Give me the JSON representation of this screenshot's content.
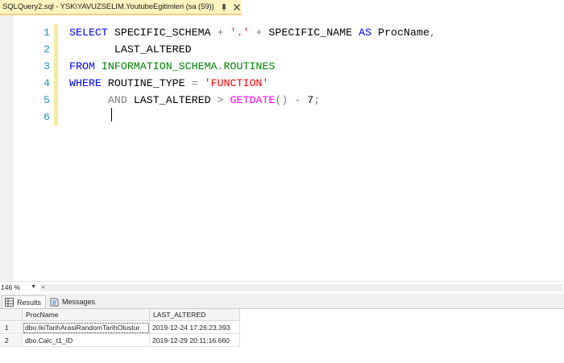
{
  "window": {
    "doc_tab_title": "SQLQuery2.sql - YSK\\YAVUZSELIM.YoutubeEgitimleri (sa (59))",
    "pin_icon": "pin-icon",
    "close_icon": "close-icon"
  },
  "editor": {
    "line_numbers": [
      "1",
      "2",
      "3",
      "4",
      "5",
      "6"
    ],
    "lines": [
      [
        {
          "c": "kw",
          "t": "SELECT"
        },
        {
          "c": "txt",
          "t": " SPECIFIC_SCHEMA "
        },
        {
          "c": "op",
          "t": "+"
        },
        {
          "c": "txt",
          "t": " "
        },
        {
          "c": "str",
          "t": "'.'"
        },
        {
          "c": "txt",
          "t": " "
        },
        {
          "c": "op",
          "t": "+"
        },
        {
          "c": "txt",
          "t": " SPECIFIC_NAME "
        },
        {
          "c": "kw",
          "t": "AS"
        },
        {
          "c": "txt",
          "t": " ProcName"
        },
        {
          "c": "op",
          "t": ","
        }
      ],
      [
        {
          "c": "txt",
          "t": "       LAST_ALTERED"
        }
      ],
      [
        {
          "c": "kw",
          "t": "FROM"
        },
        {
          "c": "txt",
          "t": " "
        },
        {
          "c": "sys",
          "t": "INFORMATION_SCHEMA"
        },
        {
          "c": "op",
          "t": "."
        },
        {
          "c": "sys",
          "t": "ROUTINES"
        }
      ],
      [
        {
          "c": "kw",
          "t": "WHERE"
        },
        {
          "c": "txt",
          "t": " ROUTINE_TYPE "
        },
        {
          "c": "op",
          "t": "="
        },
        {
          "c": "txt",
          "t": " "
        },
        {
          "c": "str",
          "t": "'FUNCTION'"
        }
      ],
      [
        {
          "c": "txt",
          "t": "      "
        },
        {
          "c": "op",
          "t": "AND"
        },
        {
          "c": "txt",
          "t": " LAST_ALTERED "
        },
        {
          "c": "op",
          "t": ">"
        },
        {
          "c": "txt",
          "t": " "
        },
        {
          "c": "fn",
          "t": "GETDATE"
        },
        {
          "c": "op",
          "t": "()"
        },
        {
          "c": "txt",
          "t": " "
        },
        {
          "c": "op",
          "t": "-"
        },
        {
          "c": "txt",
          "t": " 7"
        },
        {
          "c": "op",
          "t": ";"
        }
      ],
      []
    ]
  },
  "status": {
    "zoom_value": "146 %"
  },
  "results": {
    "tabs": [
      {
        "label": "Results",
        "icon": "grid-icon"
      },
      {
        "label": "Messages",
        "icon": "messages-icon"
      }
    ],
    "columns": [
      "",
      "ProcName",
      "LAST_ALTERED"
    ],
    "rows": [
      [
        "1",
        "dbo.IkiTarihArasiRandomTarihOlustur",
        "2019-12-24 17:26:23.393"
      ],
      [
        "2",
        "dbo.Calc_t1_ID",
        "2019-12-29 20:11:16.660"
      ]
    ]
  },
  "colors": {
    "keyword": "#0000ff",
    "system_object": "#008000",
    "string": "#ff0000",
    "function": "#ff00ff",
    "operator": "#808080",
    "line_number": "#2b91af",
    "tab_active": "#fdf4bf"
  }
}
